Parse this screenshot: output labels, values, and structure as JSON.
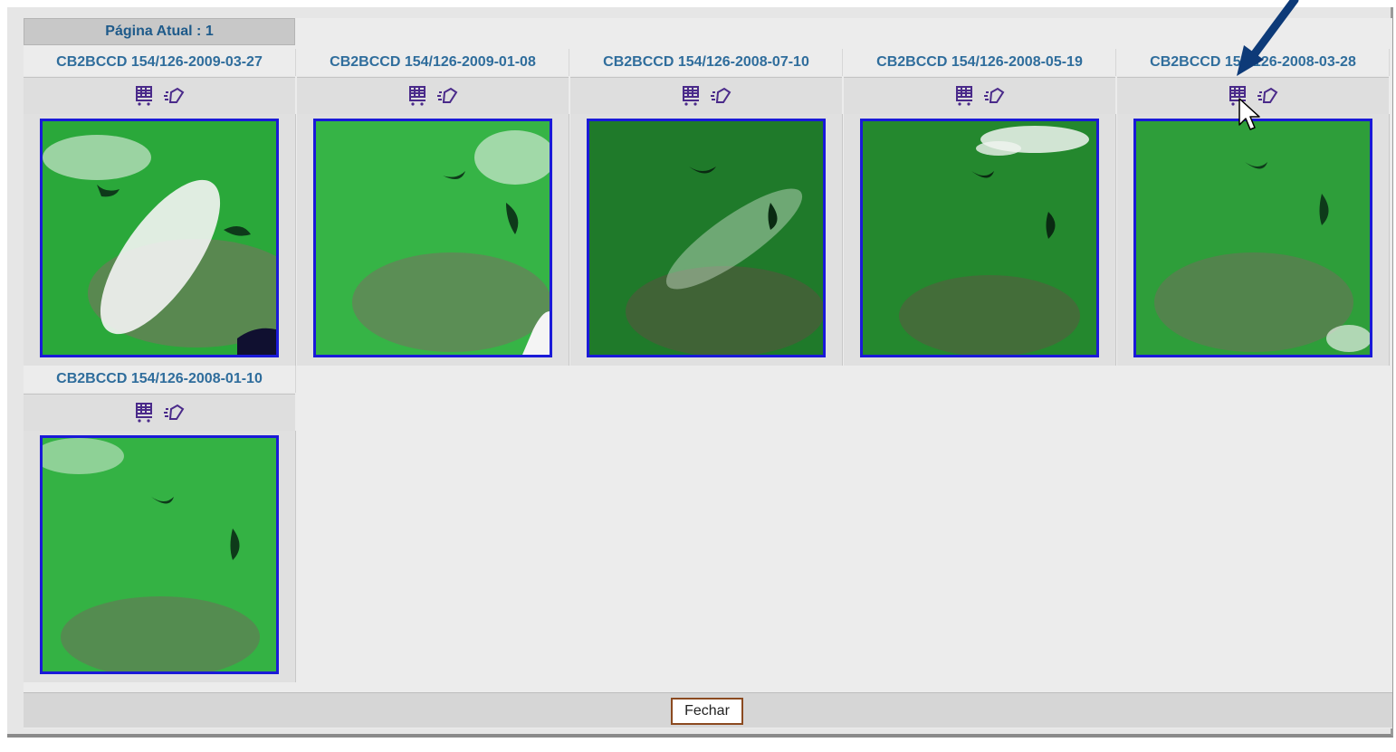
{
  "header": {
    "page_label": "Página Atual : 1"
  },
  "scenes": [
    {
      "title": "CB2BCCD 154/126-2009-03-27"
    },
    {
      "title": "CB2BCCD 154/126-2009-01-08"
    },
    {
      "title": "CB2BCCD 154/126-2008-07-10"
    },
    {
      "title": "CB2BCCD 154/126-2008-05-19"
    },
    {
      "title": "CB2BCCD 154/126-2008-03-28"
    },
    {
      "title": "CB2BCCD 154/126-2008-01-10"
    }
  ],
  "icons": {
    "cart": "shopping-cart-icon",
    "preview": "eraser-icon"
  },
  "footer": {
    "close_label": "Fechar"
  },
  "colors": {
    "title_text": "#2f6d9c",
    "thumb_border": "#1a1ad8",
    "icon_purple": "#4a2a8a",
    "annotation_arrow": "#0d3a78"
  }
}
